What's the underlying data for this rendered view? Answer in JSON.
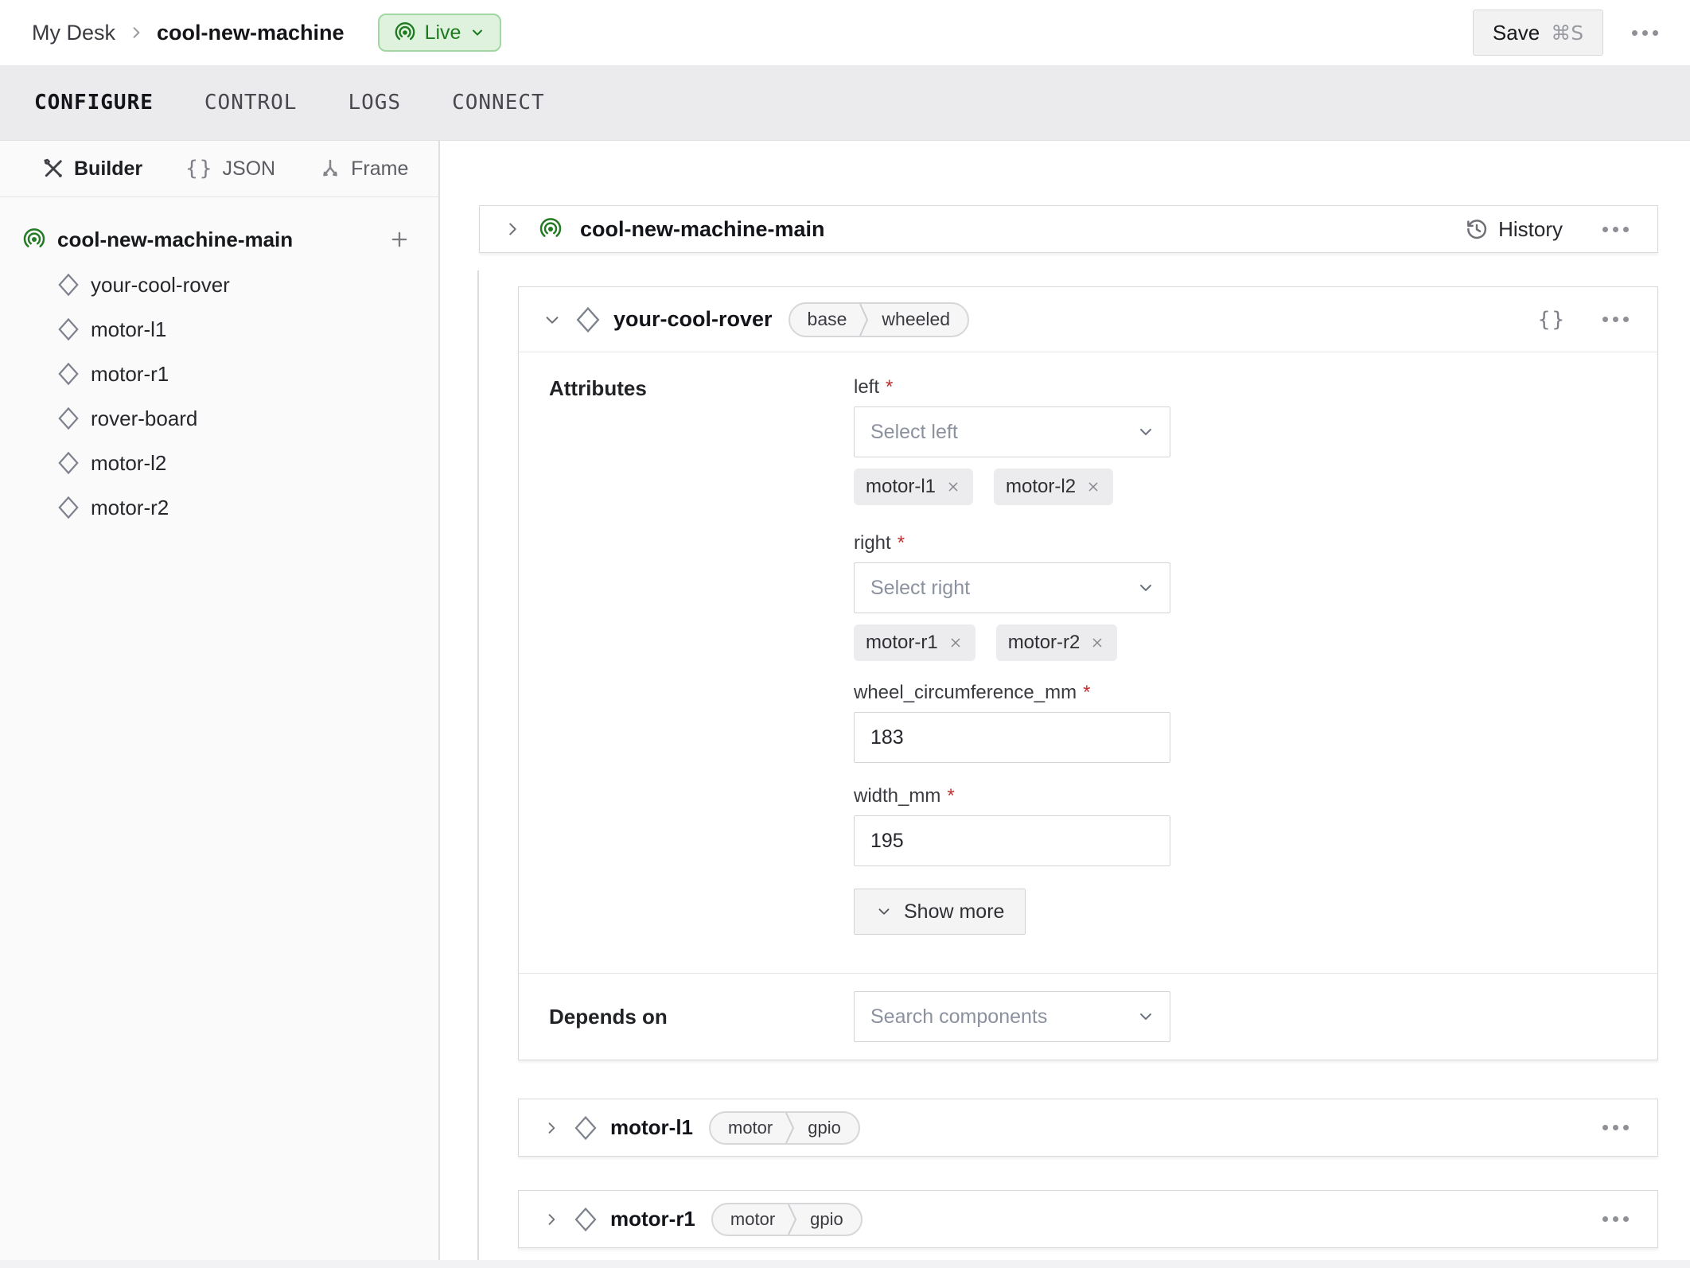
{
  "ui": {
    "required_marker": "*",
    "braces_glyph": "{}"
  },
  "colors": {
    "live_text": "#1f7a1f",
    "live_bg": "#def2de",
    "live_border": "#a3d6a3",
    "broadcast_green": "#257a25",
    "required_red": "#c22f2f",
    "tab_bar_bg": "#ebebed",
    "sidebar_bg": "#fafafa",
    "card_border": "#d9d9dc"
  },
  "header": {
    "breadcrumb": {
      "parent": "My Desk",
      "current": "cool-new-machine"
    },
    "live": {
      "label": "Live"
    },
    "save": {
      "label": "Save",
      "shortcut": "⌘S"
    }
  },
  "tabs": [
    {
      "label": "CONFIGURE"
    },
    {
      "label": "CONTROL"
    },
    {
      "label": "LOGS"
    },
    {
      "label": "CONNECT"
    }
  ],
  "sidebar": {
    "modes": [
      {
        "label": "Builder"
      },
      {
        "label": "JSON"
      },
      {
        "label": "Frame"
      }
    ],
    "tree": {
      "root": "cool-new-machine-main",
      "children": [
        "your-cool-rover",
        "motor-l1",
        "motor-r1",
        "rover-board",
        "motor-l2",
        "motor-r2"
      ]
    }
  },
  "main": {
    "part_card": {
      "title": "cool-new-machine-main",
      "history_label": "History"
    },
    "rover_card": {
      "title": "your-cool-rover",
      "tags": [
        "base",
        "wheeled"
      ],
      "attributes_label": "Attributes",
      "left": {
        "label": "left",
        "placeholder": "Select left",
        "chips": [
          "motor-l1",
          "motor-l2"
        ]
      },
      "right": {
        "label": "right",
        "placeholder": "Select right",
        "chips": [
          "motor-r1",
          "motor-r2"
        ]
      },
      "wheel": {
        "label": "wheel_circumference_mm",
        "value": "183"
      },
      "width": {
        "label": "width_mm",
        "value": "195"
      },
      "show_more": "Show more",
      "depends_on": {
        "label": "Depends on",
        "placeholder": "Search components"
      }
    },
    "motor_cards": [
      {
        "title": "motor-l1",
        "tags": [
          "motor",
          "gpio"
        ]
      },
      {
        "title": "motor-r1",
        "tags": [
          "motor",
          "gpio"
        ]
      }
    ]
  }
}
